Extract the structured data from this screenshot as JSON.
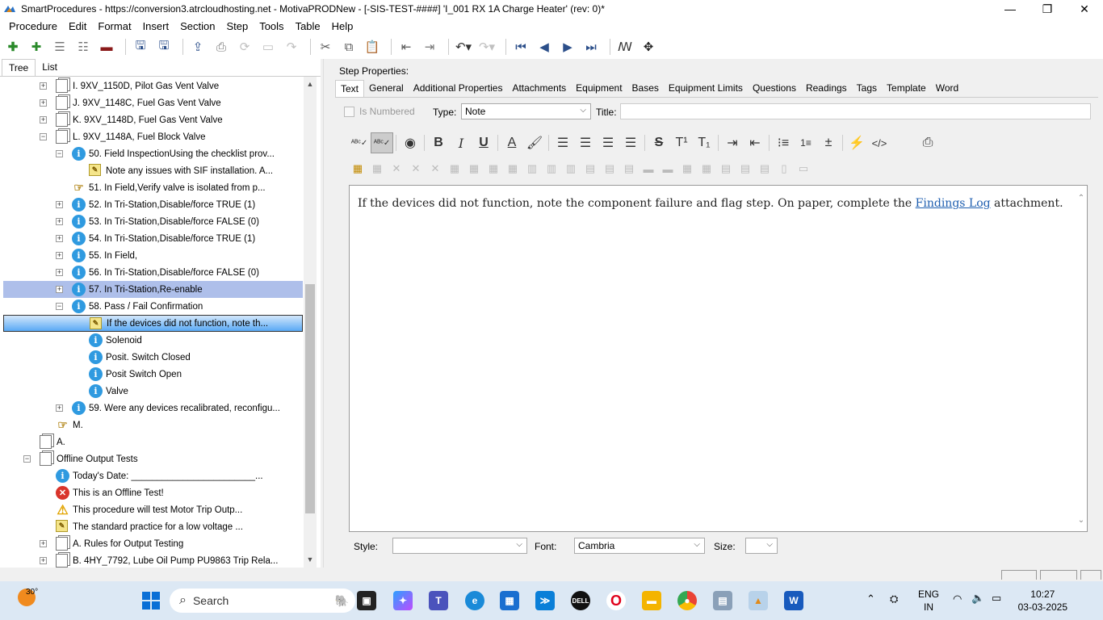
{
  "window": {
    "title": "SmartProcedures - https://conversion3.atrcloudhosting.net - MotivaPRODNew - [-SIS-TEST-####] 'I_001 RX 1A Charge Heater' (rev: 0)*",
    "minimize": "—",
    "restore": "❐",
    "close": "✕"
  },
  "menu": [
    "Procedure",
    "Edit",
    "Format",
    "Insert",
    "Section",
    "Step",
    "Tools",
    "Table",
    "Help"
  ],
  "left_tabs": {
    "tree": "Tree",
    "list": "List"
  },
  "tree": [
    {
      "text": "I. 9XV_1150D, Pilot Gas Vent Valve",
      "icon": "doc",
      "expander": "+",
      "level": 1
    },
    {
      "text": "J. 9XV_1148C, Fuel Gas Vent Valve",
      "icon": "doc",
      "expander": "+",
      "level": 1
    },
    {
      "text": "K. 9XV_1148D, Fuel Gas Vent Valve",
      "icon": "doc",
      "expander": "+",
      "level": 1
    },
    {
      "text": "L. 9XV_1148A, Fuel Block Valve",
      "icon": "doc",
      "expander": "−",
      "level": 1
    },
    {
      "text": "50. Field InspectionUsing the checklist prov...",
      "icon": "info",
      "expander": "−",
      "level": 2
    },
    {
      "text": "Note any issues with SIF installation. A...",
      "icon": "note",
      "expander": "",
      "level": 3
    },
    {
      "text": "51. In Field,Verify valve is isolated from p...",
      "icon": "hand",
      "expander": "",
      "level": 2
    },
    {
      "text": "52. In Tri-Station,Disable/force TRUE (1)",
      "icon": "info",
      "expander": "+",
      "level": 2
    },
    {
      "text": "53. In Tri-Station,Disable/force FALSE (0)",
      "icon": "info",
      "expander": "+",
      "level": 2
    },
    {
      "text": "54. In Tri-Station,Disable/force TRUE (1)",
      "icon": "info",
      "expander": "+",
      "level": 2
    },
    {
      "text": "55. In Field,",
      "icon": "info",
      "expander": "+",
      "level": 2
    },
    {
      "text": "56. In Tri-Station,Disable/force FALSE (0)",
      "icon": "info",
      "expander": "+",
      "level": 2
    },
    {
      "text": "57. In Tri-Station,Re-enable",
      "icon": "info",
      "expander": "+",
      "level": 2,
      "state": "selected"
    },
    {
      "text": "58. Pass / Fail Confirmation",
      "icon": "info",
      "expander": "−",
      "level": 2
    },
    {
      "text": "If the devices did not function, note th...",
      "icon": "note",
      "expander": "",
      "level": 3,
      "state": "current"
    },
    {
      "text": "Solenoid",
      "icon": "info",
      "expander": "",
      "level": 3
    },
    {
      "text": "Posit. Switch Closed",
      "icon": "info",
      "expander": "",
      "level": 3
    },
    {
      "text": "Posit Switch Open",
      "icon": "info",
      "expander": "",
      "level": 3
    },
    {
      "text": "Valve",
      "icon": "info",
      "expander": "",
      "level": 3
    },
    {
      "text": "59. Were any devices recalibrated, reconfigu...",
      "icon": "info",
      "expander": "+",
      "level": 2
    },
    {
      "text": "M.",
      "icon": "hand",
      "expander": "",
      "level": 1
    },
    {
      "text": "A.",
      "icon": "doc",
      "expander": "",
      "level": 0
    },
    {
      "text": "Offline Output Tests",
      "icon": "doc",
      "expander": "−",
      "level": 0
    },
    {
      "text": "Today's Date: ________________________...",
      "icon": "info",
      "expander": "",
      "level": 1
    },
    {
      "text": "This is an Offline Test!",
      "icon": "err",
      "expander": "",
      "level": 1
    },
    {
      "text": "This procedure will test Motor Trip Outp...",
      "icon": "warn",
      "expander": "",
      "level": 1
    },
    {
      "text": "The standard practice for a low voltage ...",
      "icon": "note",
      "expander": "",
      "level": 1
    },
    {
      "text": "A. Rules for Output Testing",
      "icon": "doc",
      "expander": "+",
      "level": 1
    },
    {
      "text": "B. 4HY_7792, Lube Oil Pump PU9863 Trip Rela...",
      "icon": "doc",
      "expander": "+",
      "level": 1
    }
  ],
  "step_properties": {
    "heading": "Step Properties:",
    "tabs": [
      "Text",
      "General",
      "Additional Properties",
      "Attachments",
      "Equipment",
      "Bases",
      "Equipment Limits",
      "Questions",
      "Readings",
      "Tags",
      "Template",
      "Word"
    ],
    "is_numbered_label": "Is Numbered",
    "type_label": "Type:",
    "type_value": "Note",
    "title_label": "Title:",
    "title_value": "",
    "editor_text_before": "If the devices did not function, note the component failure and flag step. On paper, complete the ",
    "editor_link": "Findings Log",
    "editor_text_after": " attachment.",
    "style_label": "Style:",
    "style_value": "",
    "font_label": "Font:",
    "font_value": "Cambria",
    "size_label": "Size:",
    "size_value": ""
  },
  "taskbar": {
    "weather_temp": "30°",
    "search_placeholder": "Search",
    "lang_line1": "ENG",
    "lang_line2": "IN",
    "time": "10:27",
    "date": "03-03-2025"
  },
  "colors": {
    "selected_row": "#aebfea",
    "current_row": "#59a9f5",
    "info_icon": "#2f9ae0",
    "link": "#1f5fb0"
  }
}
